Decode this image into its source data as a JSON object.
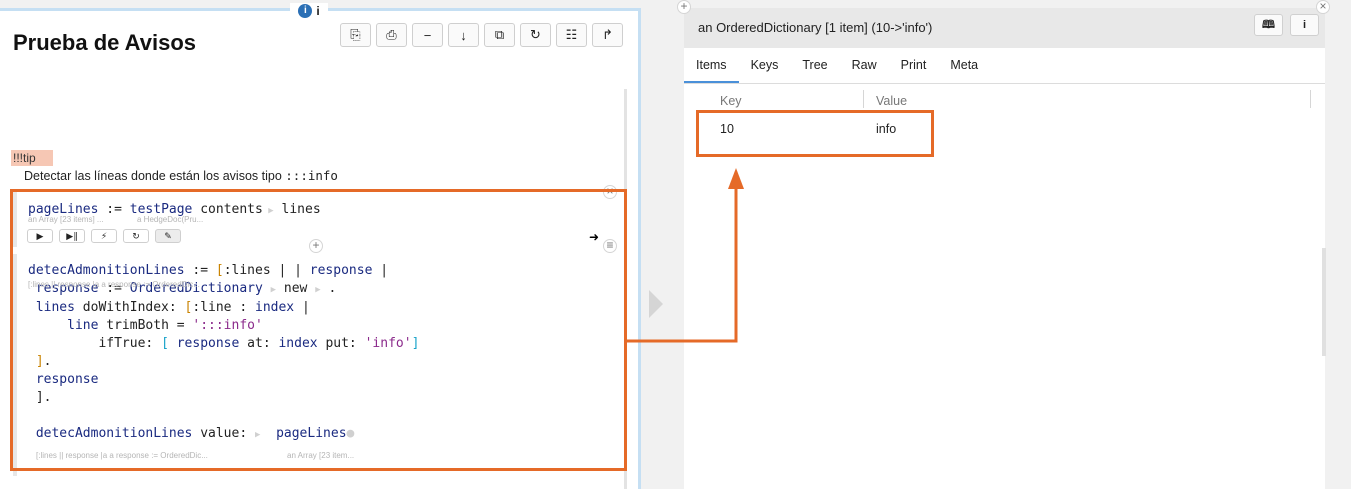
{
  "left": {
    "title": "Prueba de Avisos",
    "toolbar": [
      "copy-icon",
      "print-icon",
      "minus-icon",
      "down-arrow-icon",
      "duplicate-icon",
      "refresh-icon",
      "clipboard-icon",
      "share-icon"
    ],
    "tip": {
      "badge": "!!!tip",
      "text": "Detectar las líneas donde están los avisos tipo",
      "code": ":::info"
    },
    "cell1": {
      "line": [
        "pageLines",
        " := ",
        "testPage",
        " contents",
        " lines"
      ],
      "label1": "an Array [23 items] ...",
      "label2": "a HedgeDoc(Pru...",
      "controls": [
        "▶",
        "▶∥",
        "⚡",
        "↻",
        "✎"
      ]
    },
    "cell2": {
      "lines": [
        "detecAdmonitionLines := [:lines | | response |",
        " response := OrderedDictionary  new  .",
        " lines doWithIndex: [:line : index |",
        "     line trimBoth = ':::info'",
        "         ifTrue: [ response at: index put: 'info']",
        " ].",
        " response",
        " ].",
        "",
        " detecAdmonitionLines value:  pageLines"
      ],
      "label_top": "[:lines || response |a a response := OrderedDic...",
      "label_bottom1": "[:lines || response |a a response := OrderedDic...",
      "label_bottom2": "an Array [23 item..."
    }
  },
  "right": {
    "title": "an OrderedDictionary [1 item] (10->'info')",
    "btn_book": "📖",
    "btn_info": "i",
    "tabs": [
      "Items",
      "Keys",
      "Tree",
      "Raw",
      "Print",
      "Meta"
    ],
    "columns": [
      "Key",
      "Value"
    ],
    "rows": [
      {
        "key": "10",
        "value": "info"
      }
    ]
  },
  "top_info": "i"
}
